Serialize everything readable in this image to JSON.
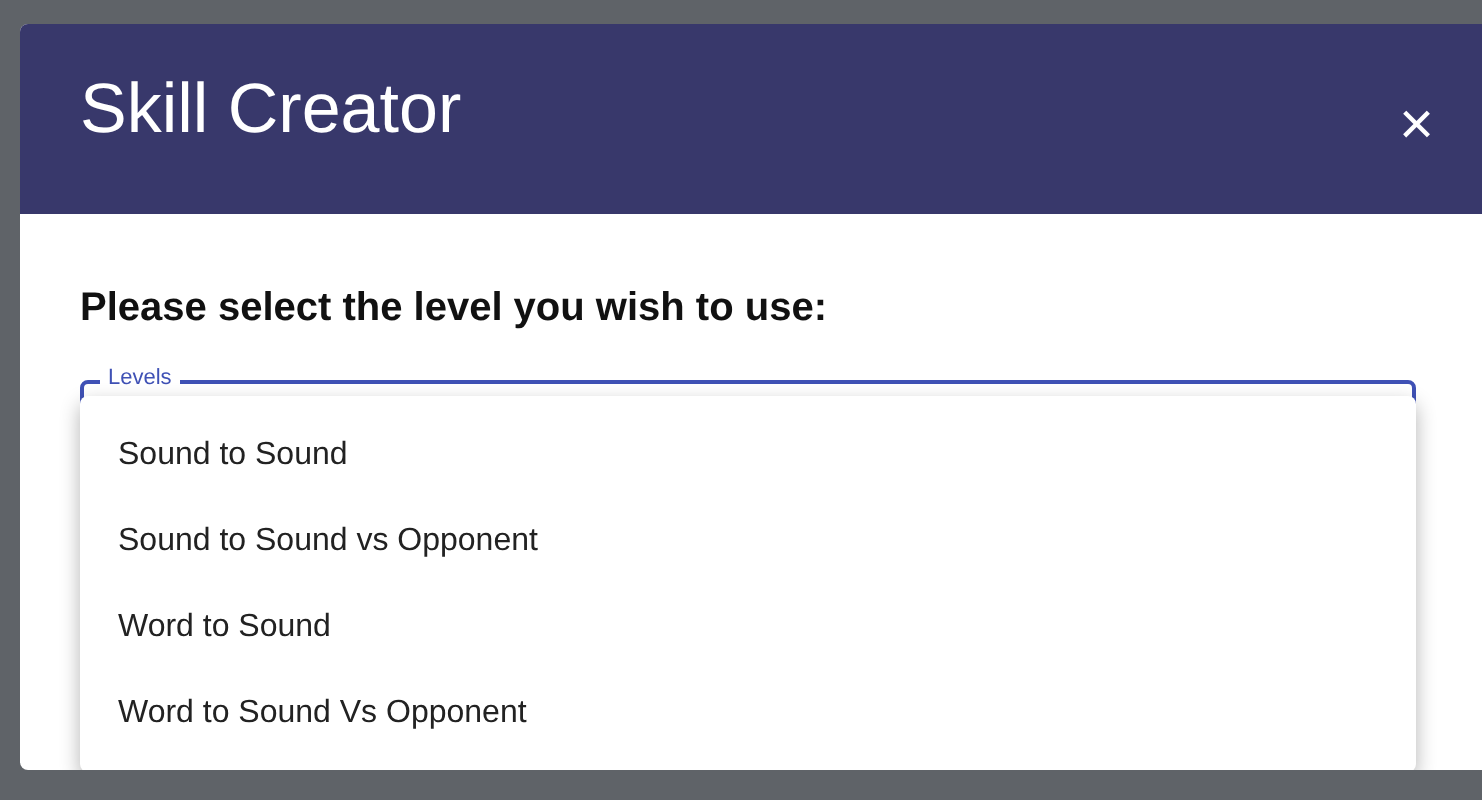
{
  "dialog": {
    "title": "Skill Creator",
    "close": "×"
  },
  "prompt": "Please select the level you wish to use:",
  "field": {
    "label": "Levels"
  },
  "menu": {
    "options": [
      {
        "label": "Sound to Sound"
      },
      {
        "label": "Sound to Sound vs Opponent"
      },
      {
        "label": "Word to Sound"
      },
      {
        "label": "Word to Sound Vs Opponent"
      }
    ]
  }
}
